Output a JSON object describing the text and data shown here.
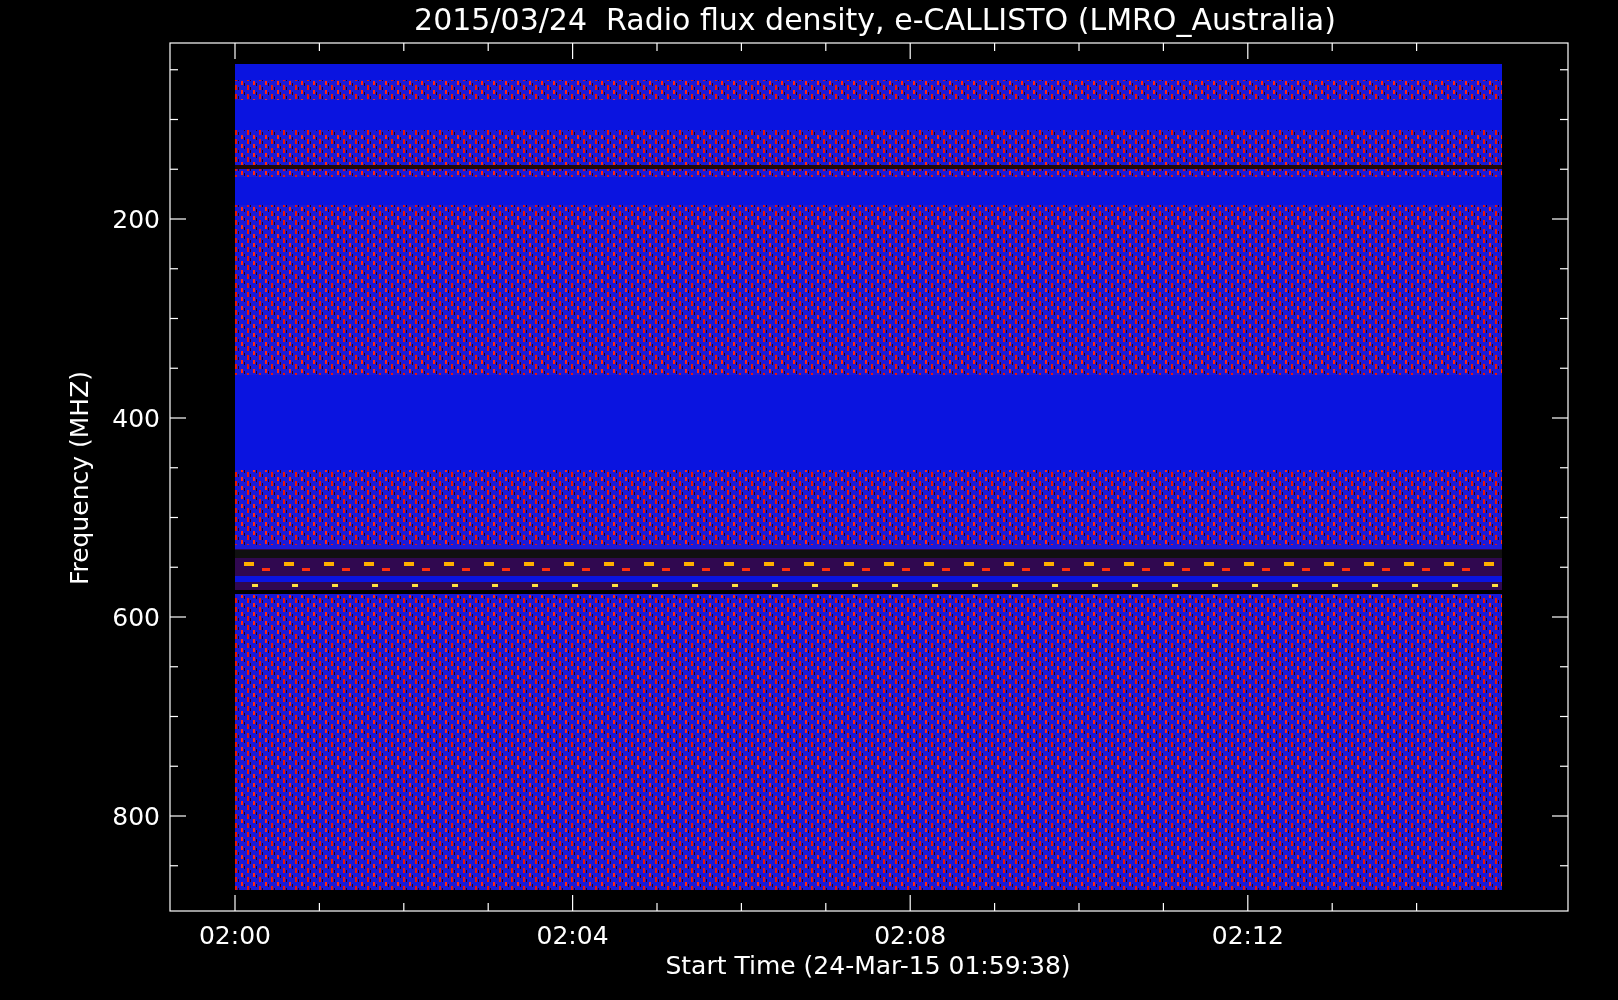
{
  "plot": {
    "title": "2015/03/24  Radio flux density, e-CALLISTO (LMRO_Australia)",
    "y_axis": {
      "label": "Frequency (MHZ)",
      "ticks": [
        "200",
        "400",
        "600",
        "800"
      ]
    },
    "x_axis": {
      "label": "Start Time (24-Mar-15 01:59:38)",
      "ticks": [
        "02:00",
        "02:04",
        "02:08",
        "02:12"
      ]
    }
  }
}
